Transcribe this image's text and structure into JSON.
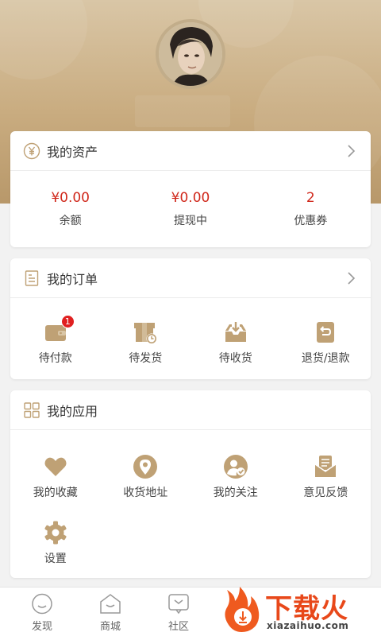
{
  "colors": {
    "accent": "#bfa175",
    "price_red": "#d0281b",
    "badge_red": "#e02020"
  },
  "assets": {
    "title": "我的资产",
    "items": [
      {
        "value": "¥0.00",
        "label": "余额"
      },
      {
        "value": "¥0.00",
        "label": "提现中"
      },
      {
        "value": "2",
        "label": "优惠券"
      }
    ]
  },
  "orders": {
    "title": "我的订单",
    "items": [
      {
        "label": "待付款",
        "icon": "wallet-icon",
        "badge": "1"
      },
      {
        "label": "待发货",
        "icon": "package-clock-icon"
      },
      {
        "label": "待收货",
        "icon": "inbox-download-icon"
      },
      {
        "label": "退货/退款",
        "icon": "return-icon"
      }
    ]
  },
  "apps": {
    "title": "我的应用",
    "items": [
      {
        "label": "我的收藏",
        "icon": "heart-icon"
      },
      {
        "label": "收货地址",
        "icon": "location-pin-icon"
      },
      {
        "label": "我的关注",
        "icon": "user-check-icon"
      },
      {
        "label": "意见反馈",
        "icon": "feedback-mail-icon"
      },
      {
        "label": "设置",
        "icon": "gear-icon"
      }
    ]
  },
  "tabbar": {
    "items": [
      {
        "label": "发现",
        "icon": "smile-face-icon"
      },
      {
        "label": "商城",
        "icon": "shop-house-icon"
      },
      {
        "label": "社区",
        "icon": "chat-bubble-icon"
      }
    ]
  },
  "watermark": {
    "brand": "下载火",
    "url": "xiazaihuo.com"
  }
}
